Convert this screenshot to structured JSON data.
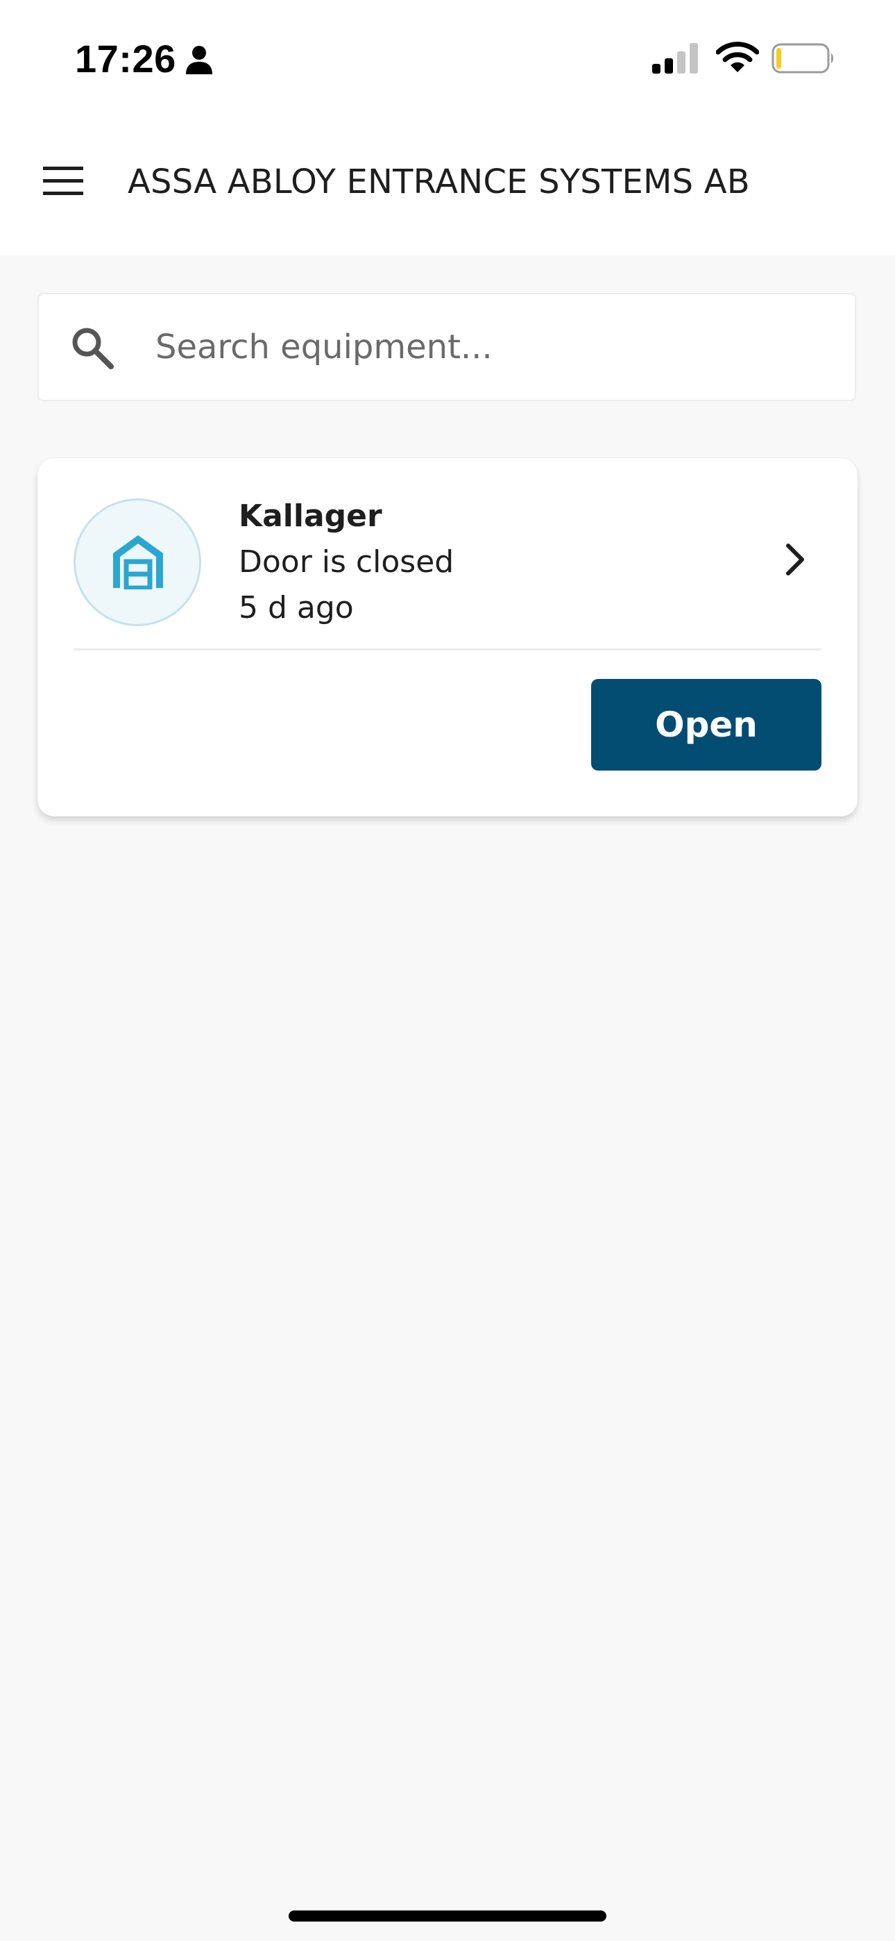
{
  "status_bar": {
    "time": "17:26",
    "icons": [
      "person-icon",
      "cellular-signal-icon",
      "wifi-icon",
      "battery-icon"
    ],
    "signal_bars_active": 2,
    "signal_bars_total": 4,
    "battery_level": 0.1,
    "battery_color": "#f5cc1f"
  },
  "header": {
    "menu_icon": "hamburger-menu-icon",
    "title": "ASSA ABLOY ENTRANCE SYSTEMS AB"
  },
  "search": {
    "icon": "search-icon",
    "placeholder": "Search equipment...",
    "value": ""
  },
  "equipment": [
    {
      "icon": "garage-door-icon",
      "name": "Kallager",
      "status": "Door is closed",
      "last_update": "5 d ago",
      "action_label": "Open",
      "chevron_icon": "chevron-right-icon"
    }
  ],
  "colors": {
    "primary_button": "#034d73",
    "icon_accent": "#2aa6d1",
    "avatar_background": "#eef7fa",
    "page_background": "#f8f8f8",
    "header_background": "#ffffff"
  }
}
